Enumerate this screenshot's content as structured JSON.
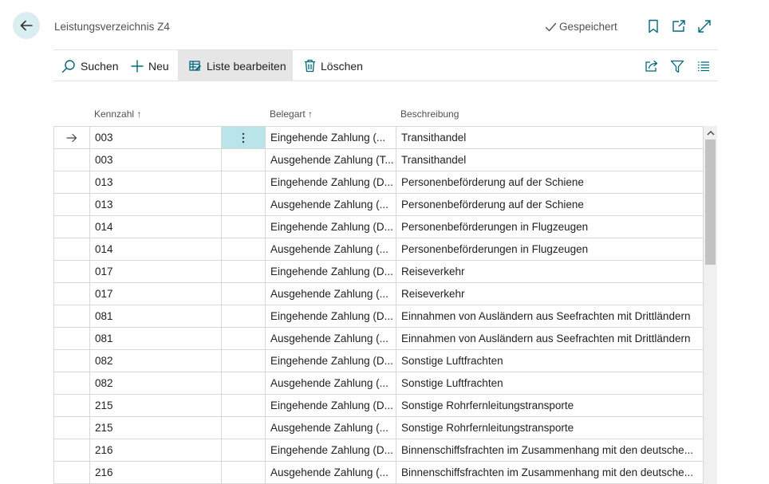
{
  "header": {
    "title": "Leistungsverzeichnis Z4",
    "status": "Gespeichert"
  },
  "actions": {
    "search": "Suchen",
    "new": "Neu",
    "edit_list": "Liste bearbeiten",
    "delete": "Löschen"
  },
  "columns": {
    "kennzahl": "Kennzahl",
    "belegart": "Belegart",
    "beschreibung": "Beschreibung",
    "sort_arrow": "↑"
  },
  "rows": [
    {
      "kennzahl": "003",
      "belegart": "Eingehende Zahlung (...",
      "beschreibung": "Transithandel"
    },
    {
      "kennzahl": "003",
      "belegart": "Ausgehende Zahlung (T...",
      "beschreibung": "Transithandel"
    },
    {
      "kennzahl": "013",
      "belegart": "Eingehende Zahlung (D...",
      "beschreibung": "Personenbeförderung auf der Schiene"
    },
    {
      "kennzahl": "013",
      "belegart": "Ausgehende Zahlung (...",
      "beschreibung": "Personenbeförderung auf der Schiene"
    },
    {
      "kennzahl": "014",
      "belegart": "Eingehende Zahlung (D...",
      "beschreibung": "Personenbeförderungen in Flugzeugen"
    },
    {
      "kennzahl": "014",
      "belegart": "Ausgehende Zahlung (...",
      "beschreibung": "Personenbeförderungen in Flugzeugen"
    },
    {
      "kennzahl": "017",
      "belegart": "Eingehende Zahlung (D...",
      "beschreibung": "Reiseverkehr"
    },
    {
      "kennzahl": "017",
      "belegart": "Ausgehende Zahlung (...",
      "beschreibung": "Reiseverkehr"
    },
    {
      "kennzahl": "081",
      "belegart": "Eingehende Zahlung (D...",
      "beschreibung": "Einnahmen von Ausländern aus Seefrachten mit Drittländern"
    },
    {
      "kennzahl": "081",
      "belegart": "Ausgehende Zahlung (...",
      "beschreibung": "Einnahmen von Ausländern aus Seefrachten mit Drittländern"
    },
    {
      "kennzahl": "082",
      "belegart": "Eingehende Zahlung (D...",
      "beschreibung": "Sonstige Luftfrachten"
    },
    {
      "kennzahl": "082",
      "belegart": "Ausgehende Zahlung (...",
      "beschreibung": "Sonstige Luftfrachten"
    },
    {
      "kennzahl": "215",
      "belegart": "Eingehende Zahlung (D...",
      "beschreibung": "Sonstige Rohrfernleitungstransporte"
    },
    {
      "kennzahl": "215",
      "belegart": "Ausgehende Zahlung (...",
      "beschreibung": "Sonstige Rohrfernleitungstransporte"
    },
    {
      "kennzahl": "216",
      "belegart": "Eingehende Zahlung (D...",
      "beschreibung": "Binnenschiffsfrachten im Zusammenhang mit den deutsche..."
    },
    {
      "kennzahl": "216",
      "belegart": "Ausgehende Zahlung (...",
      "beschreibung": "Binnenschiffsfrachten im Zusammenhang mit den deutsche..."
    }
  ],
  "selected_row": 0,
  "colors": {
    "accent": "#00687a",
    "back_button_bg": "#d9eef0",
    "selected_cell_bg": "#b8e4ea"
  },
  "icons": [
    "back-arrow-icon",
    "checkmark-icon",
    "bookmark-icon",
    "open-new-window-icon",
    "expand-icon",
    "search-icon",
    "plus-icon",
    "edit-list-icon",
    "trash-icon",
    "share-icon",
    "filter-icon",
    "list-view-icon",
    "row-arrow-icon",
    "more-options-icon",
    "scroll-up-icon"
  ]
}
